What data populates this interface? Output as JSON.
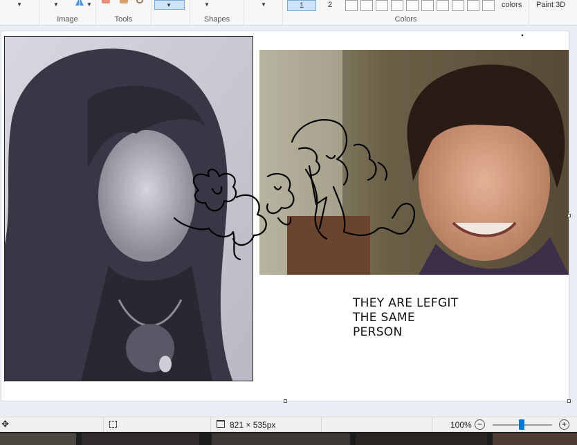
{
  "ribbon": {
    "groups": {
      "image": "Image",
      "tools": "Tools",
      "shapes": "Shapes",
      "colors": "Colors"
    },
    "size_options": [
      "1",
      "2"
    ],
    "edit_colors_label": "colors",
    "paint3d_label": "Paint 3D"
  },
  "canvas": {
    "caption": "THEY ARE LEFGIT\nTHE SAME\nPERSON"
  },
  "statusbar": {
    "image_size": "821 × 535px",
    "zoom": "100%"
  }
}
